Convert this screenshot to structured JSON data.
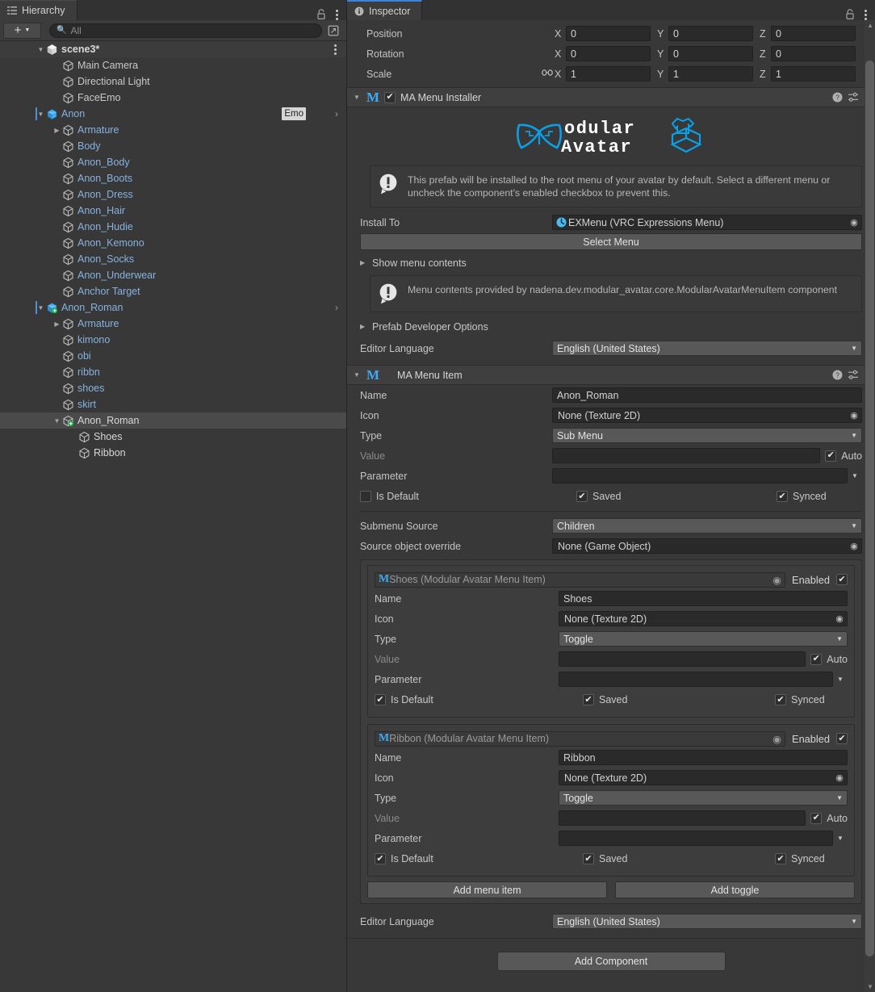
{
  "hierarchy": {
    "tab_label": "Hierarchy",
    "tab_icon": "hierarchy-icon",
    "add_button": "+",
    "search_placeholder": "All",
    "scene_name": "scene3*",
    "items": [
      {
        "label": "Main Camera",
        "depth": 2,
        "twisty": "none",
        "style": "plain"
      },
      {
        "label": "Directional Light",
        "depth": 2,
        "twisty": "none",
        "style": "plain"
      },
      {
        "label": "FaceEmo",
        "depth": 2,
        "twisty": "none",
        "style": "plain"
      },
      {
        "label": "Anon",
        "depth": 1,
        "twisty": "open",
        "style": "prefab",
        "badge": "Emo",
        "chevron": true,
        "marker": true,
        "prefabRoot": true
      },
      {
        "label": "Armature",
        "depth": 2,
        "twisty": "closed",
        "style": "prefab"
      },
      {
        "label": "Body",
        "depth": 2,
        "twisty": "none",
        "style": "prefab"
      },
      {
        "label": "Anon_Body",
        "depth": 2,
        "twisty": "none",
        "style": "prefab"
      },
      {
        "label": "Anon_Boots",
        "depth": 2,
        "twisty": "none",
        "style": "prefab"
      },
      {
        "label": "Anon_Dress",
        "depth": 2,
        "twisty": "none",
        "style": "prefab"
      },
      {
        "label": "Anon_Hair",
        "depth": 2,
        "twisty": "none",
        "style": "prefab"
      },
      {
        "label": "Anon_Hudie",
        "depth": 2,
        "twisty": "none",
        "style": "prefab"
      },
      {
        "label": "Anon_Kemono",
        "depth": 2,
        "twisty": "none",
        "style": "prefab"
      },
      {
        "label": "Anon_Socks",
        "depth": 2,
        "twisty": "none",
        "style": "prefab"
      },
      {
        "label": "Anon_Underwear",
        "depth": 2,
        "twisty": "none",
        "style": "prefab"
      },
      {
        "label": "Anchor Target",
        "depth": 2,
        "twisty": "none",
        "style": "prefab"
      },
      {
        "label": "Anon_Roman",
        "depth": 1,
        "twisty": "open",
        "style": "prefab",
        "chevron": true,
        "marker": true,
        "variant": true
      },
      {
        "label": "Armature",
        "depth": 2,
        "twisty": "closed",
        "style": "prefab"
      },
      {
        "label": "kimono",
        "depth": 2,
        "twisty": "none",
        "style": "prefab"
      },
      {
        "label": "obi",
        "depth": 2,
        "twisty": "none",
        "style": "prefab"
      },
      {
        "label": "ribbn",
        "depth": 2,
        "twisty": "none",
        "style": "prefab"
      },
      {
        "label": "shoes",
        "depth": 2,
        "twisty": "none",
        "style": "prefab"
      },
      {
        "label": "skirt",
        "depth": 2,
        "twisty": "none",
        "style": "prefab"
      },
      {
        "label": "Anon_Roman",
        "depth": 2,
        "twisty": "open",
        "style": "white",
        "selected": true,
        "variant": true
      },
      {
        "label": "Shoes",
        "depth": 3,
        "twisty": "none",
        "style": "white"
      },
      {
        "label": "Ribbon",
        "depth": 3,
        "twisty": "none",
        "style": "white"
      }
    ]
  },
  "inspector": {
    "tab_label": "Inspector",
    "transform": {
      "rows": [
        {
          "label": "Position",
          "link": false,
          "x": "0",
          "y": "0",
          "z": "0"
        },
        {
          "label": "Rotation",
          "link": false,
          "x": "0",
          "y": "0",
          "z": "0"
        },
        {
          "label": "Scale",
          "link": true,
          "x": "1",
          "y": "1",
          "z": "1"
        }
      ],
      "axis_x": "X",
      "axis_y": "Y",
      "axis_z": "Z"
    },
    "menu_installer": {
      "title": "MA Menu Installer",
      "enabled": true,
      "logo_top": "odular",
      "logo_bottom": "Avatar",
      "help_text": "This prefab will be installed to the root menu of your avatar by default. Select a different menu or uncheck the component's enabled checkbox to prevent this.",
      "install_to_label": "Install To",
      "install_to_value": "EXMenu (VRC Expressions Menu)",
      "select_menu_button": "Select Menu",
      "show_menu_contents": "Show menu contents",
      "menu_contents_note": "Menu contents provided by nadena.dev.modular_avatar.core.ModularAvatarMenuItem component",
      "prefab_developer_options": "Prefab Developer Options",
      "editor_language_label": "Editor Language",
      "editor_language_value": "English (United States)"
    },
    "menu_item": {
      "title": "MA Menu Item",
      "name_label": "Name",
      "name_value": "Anon_Roman",
      "icon_label": "Icon",
      "icon_value": "None (Texture 2D)",
      "type_label": "Type",
      "type_value": "Sub Menu",
      "value_label": "Value",
      "value_value": "",
      "auto_label": "Auto",
      "auto_checked": true,
      "parameter_label": "Parameter",
      "parameter_value": "",
      "is_default_label": "Is Default",
      "is_default_checked": false,
      "saved_label": "Saved",
      "saved_checked": true,
      "synced_label": "Synced",
      "synced_checked": true,
      "submenu_source_label": "Submenu Source",
      "submenu_source_value": "Children",
      "source_object_override_label": "Source object override",
      "source_object_override_value": "None (Game Object)",
      "children": [
        {
          "ref_label": "Shoes (Modular Avatar Menu Item)",
          "enabled_label": "Enabled",
          "enabled_checked": true,
          "name_label": "Name",
          "name_value": "Shoes",
          "icon_label": "Icon",
          "icon_value": "None (Texture 2D)",
          "type_label": "Type",
          "type_value": "Toggle",
          "value_label": "Value",
          "value_value": "",
          "auto_label": "Auto",
          "auto_checked": true,
          "parameter_label": "Parameter",
          "parameter_value": "",
          "is_default_label": "Is Default",
          "is_default_checked": true,
          "saved_label": "Saved",
          "saved_checked": true,
          "synced_label": "Synced",
          "synced_checked": true
        },
        {
          "ref_label": "Ribbon (Modular Avatar Menu Item)",
          "enabled_label": "Enabled",
          "enabled_checked": true,
          "name_label": "Name",
          "name_value": "Ribbon",
          "icon_label": "Icon",
          "icon_value": "None (Texture 2D)",
          "type_label": "Type",
          "type_value": "Toggle",
          "value_label": "Value",
          "value_value": "",
          "auto_label": "Auto",
          "auto_checked": true,
          "parameter_label": "Parameter",
          "parameter_value": "",
          "is_default_label": "Is Default",
          "is_default_checked": true,
          "saved_label": "Saved",
          "saved_checked": true,
          "synced_label": "Synced",
          "synced_checked": true
        }
      ],
      "add_menu_item_button": "Add menu item",
      "add_toggle_button": "Add toggle",
      "editor_language_label": "Editor Language",
      "editor_language_value": "English (United States)"
    },
    "add_component_button": "Add Component"
  },
  "colors": {
    "accent_blue": "#3fa9f5",
    "prefab_blue": "#86b2e0",
    "tab_accent": "#3d82d6",
    "variant_green": "#19b34a",
    "panel_bg": "#383838",
    "field_bg": "#2a2a2a",
    "dropdown_bg": "#585858"
  }
}
